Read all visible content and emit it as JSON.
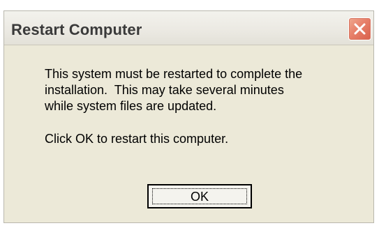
{
  "dialog": {
    "title": "Restart Computer",
    "close_icon": "close-icon",
    "message_lines": [
      "This system must be restarted to complete the",
      "installation.  This may take several minutes",
      "while system files are updated."
    ],
    "instruction": "Click OK to restart this computer.",
    "ok_label": "OK"
  },
  "colors": {
    "window_bg": "#ece9d8",
    "close_button": "#e7806a"
  }
}
